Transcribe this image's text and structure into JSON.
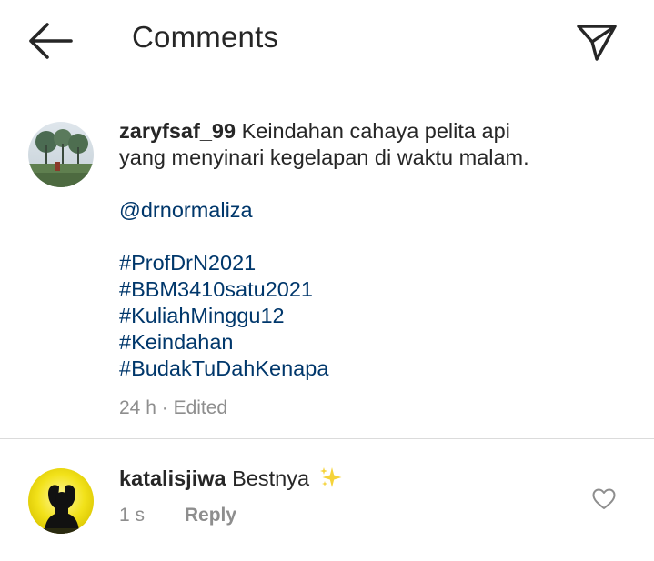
{
  "header": {
    "title": "Comments",
    "back_icon": "arrow-left-icon",
    "send_icon": "paper-plane-icon"
  },
  "post": {
    "username": "zaryfsaf_99",
    "caption_line1": "Keindahan cahaya pelita api",
    "caption_line2": "yang menyinari kegelapan di waktu malam.",
    "mention": "@drnormaliza",
    "hashtags": [
      "#ProfDrN2021",
      "#BBM3410satu2021",
      "#KuliahMinggu12",
      "#Keindahan",
      "#BudakTuDahKenapa"
    ],
    "time": "24 h",
    "separator": "·",
    "edited": "Edited"
  },
  "comments": [
    {
      "username": "katalisjiwa",
      "text": "Bestnya",
      "emoji_icon": "sparkles-icon",
      "time": "1 s",
      "reply_label": "Reply",
      "like_icon": "heart-outline-icon"
    }
  ],
  "colors": {
    "text": "#262626",
    "secondary": "#8e8e8e",
    "link": "#00376b",
    "divider": "#dbdbdb",
    "sparkle": "#f5d33a"
  }
}
